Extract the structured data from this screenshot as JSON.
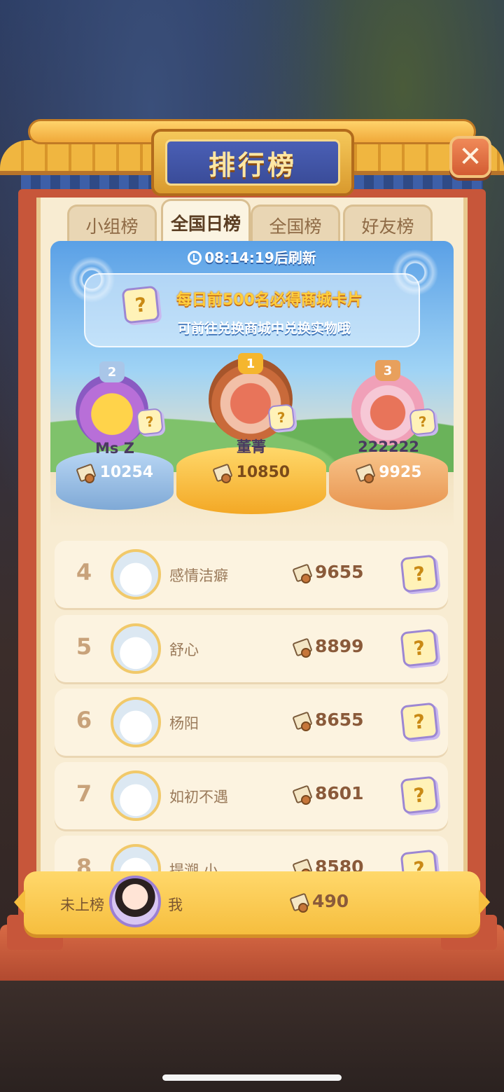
{
  "title": "排行榜",
  "close_glyph": "✕",
  "tabs": [
    {
      "label": "小组榜",
      "active": false
    },
    {
      "label": "全国日榜",
      "active": true
    },
    {
      "label": "全国榜",
      "active": false
    },
    {
      "label": "好友榜",
      "active": false
    }
  ],
  "refresh_text": "08:14:19后刷新",
  "notice": {
    "line1": "每日前500名必得商城卡片",
    "line2": "可前往兑换商城中兑换实物哦"
  },
  "card_glyph": "?",
  "podium": [
    {
      "rank": "2",
      "name": "Ms    Z",
      "score": "10254",
      "color": "#9cc4ec"
    },
    {
      "rank": "1",
      "name": "董菁",
      "score": "10850",
      "color": "#f8c13a"
    },
    {
      "rank": "3",
      "name": "222222",
      "score": "9925",
      "color": "#f2ad6a"
    }
  ],
  "rows": [
    {
      "rank": "4",
      "name": "感情洁癖",
      "score": "9655"
    },
    {
      "rank": "5",
      "name": "舒心",
      "score": "8899"
    },
    {
      "rank": "6",
      "name": "杨阳",
      "score": "8655"
    },
    {
      "rank": "7",
      "name": "如初不遇",
      "score": "8601"
    },
    {
      "rank": "8",
      "name": "提溯    小",
      "score": "8580"
    }
  ],
  "self": {
    "rank_label": "未上榜",
    "name": "我",
    "score": "490"
  },
  "colors": {
    "frame": "#c7563a",
    "panel": "#f8ecd2",
    "gold": "#f6be3e",
    "title_blue": "#3a4c99"
  }
}
